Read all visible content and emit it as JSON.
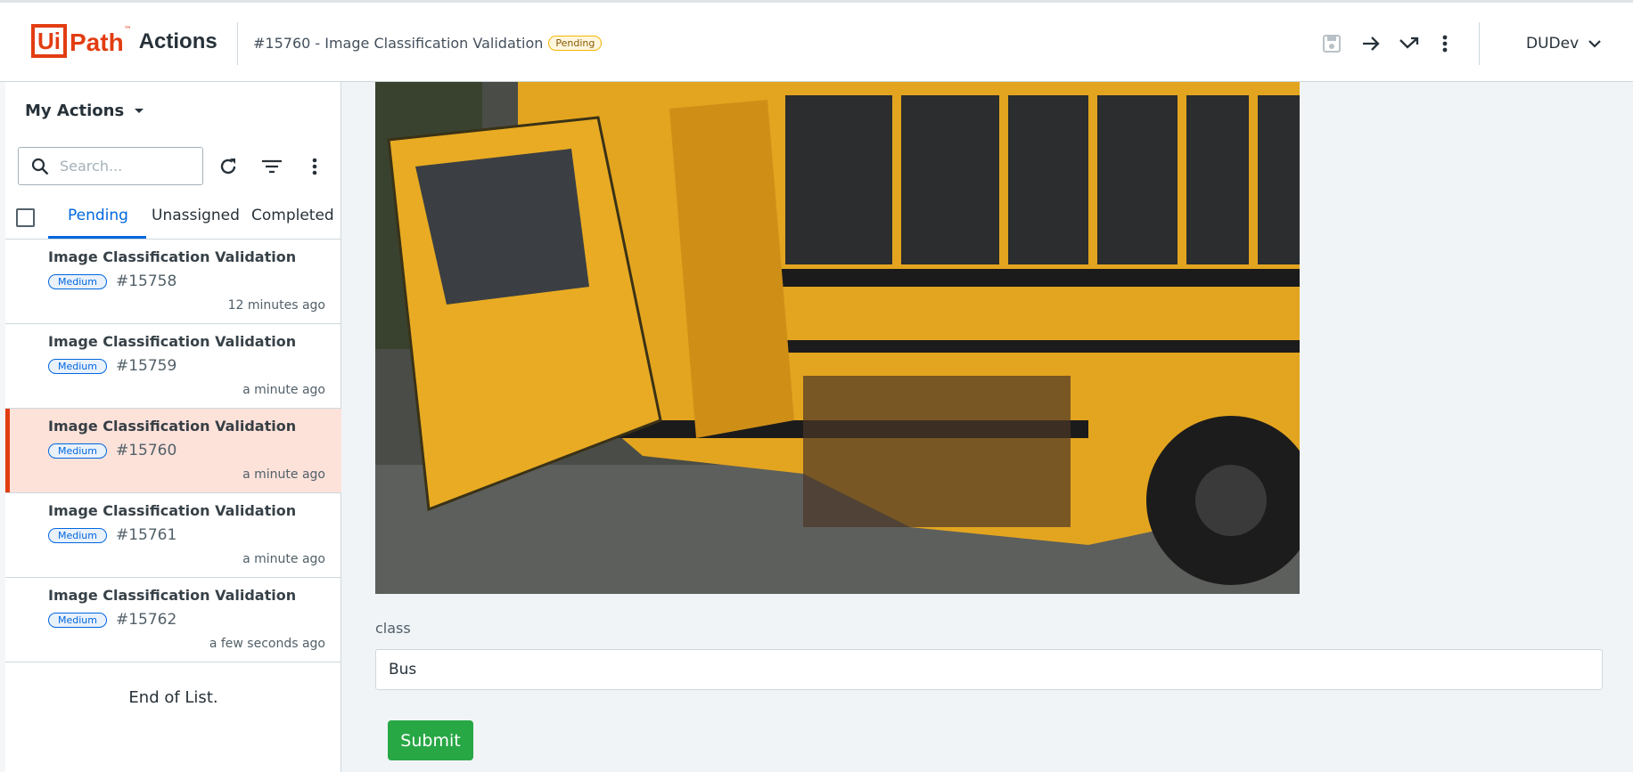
{
  "header": {
    "logo_text": "UiPath",
    "app_name": "Actions",
    "task_title": "#15760 - Image Classification Validation",
    "status_badge": "Pending",
    "icons": [
      "save-icon",
      "forward-arrow-icon",
      "reassign-icon",
      "more-vertical-icon"
    ],
    "user": "DUDev"
  },
  "sidebar": {
    "view_label": "My Actions",
    "search_placeholder": "Search...",
    "tabs": [
      "Pending",
      "Unassigned",
      "Completed"
    ],
    "active_tab": "Pending",
    "items": [
      {
        "title": "Image Classification Validation",
        "priority": "Medium",
        "id": "#15758",
        "time": "12 minutes ago",
        "selected": false
      },
      {
        "title": "Image Classification Validation",
        "priority": "Medium",
        "id": "#15759",
        "time": "a minute ago",
        "selected": false
      },
      {
        "title": "Image Classification Validation",
        "priority": "Medium",
        "id": "#15760",
        "time": "a minute ago",
        "selected": true
      },
      {
        "title": "Image Classification Validation",
        "priority": "Medium",
        "id": "#15761",
        "time": "a minute ago",
        "selected": false
      },
      {
        "title": "Image Classification Validation",
        "priority": "Medium",
        "id": "#15762",
        "time": "a few seconds ago",
        "selected": false
      }
    ],
    "end_text": "End of List."
  },
  "form": {
    "field_label": "class",
    "field_value": "Bus",
    "submit_label": "Submit"
  },
  "colors": {
    "brand": "#e23d12",
    "accent": "#0067df",
    "submit": "#28a745",
    "selected_bg": "#fde2da"
  }
}
